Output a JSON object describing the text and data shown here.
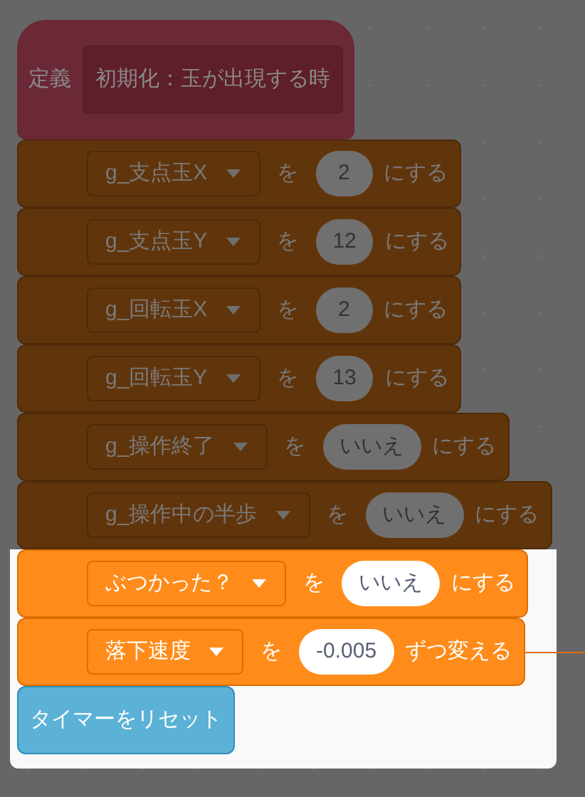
{
  "definition": {
    "keyword": "定義",
    "name": "初期化：玉が出現する時",
    "highlighted": false
  },
  "blocks": [
    {
      "kind": "variable",
      "variable": "g_支点玉X",
      "word": "を",
      "value": "2",
      "suffix": "にする",
      "highlighted": false
    },
    {
      "kind": "variable",
      "variable": "g_支点玉Y",
      "word": "を",
      "value": "12",
      "suffix": "にする",
      "highlighted": false
    },
    {
      "kind": "variable",
      "variable": "g_回転玉X",
      "word": "を",
      "value": "2",
      "suffix": "にする",
      "highlighted": false
    },
    {
      "kind": "variable",
      "variable": "g_回転玉Y",
      "word": "を",
      "value": "13",
      "suffix": "にする",
      "highlighted": false
    },
    {
      "kind": "variable",
      "variable": "g_操作終了",
      "word": "を",
      "value": "いいえ",
      "suffix": "にする",
      "highlighted": false
    },
    {
      "kind": "variable",
      "variable": "g_操作中の半歩",
      "word": "を",
      "value": "いいえ",
      "suffix": "にする",
      "highlighted": false
    },
    {
      "kind": "variable",
      "variable": "ぶつかった？",
      "word": "を",
      "value": "いいえ",
      "suffix": "にする",
      "highlighted": true
    },
    {
      "kind": "variable",
      "variable": "落下速度",
      "word": "を",
      "value": "-0.005",
      "suffix": "ずつ変える",
      "highlighted": true,
      "connected": true
    },
    {
      "kind": "command",
      "label": "タイマーをリセット",
      "highlighted": true
    }
  ]
}
